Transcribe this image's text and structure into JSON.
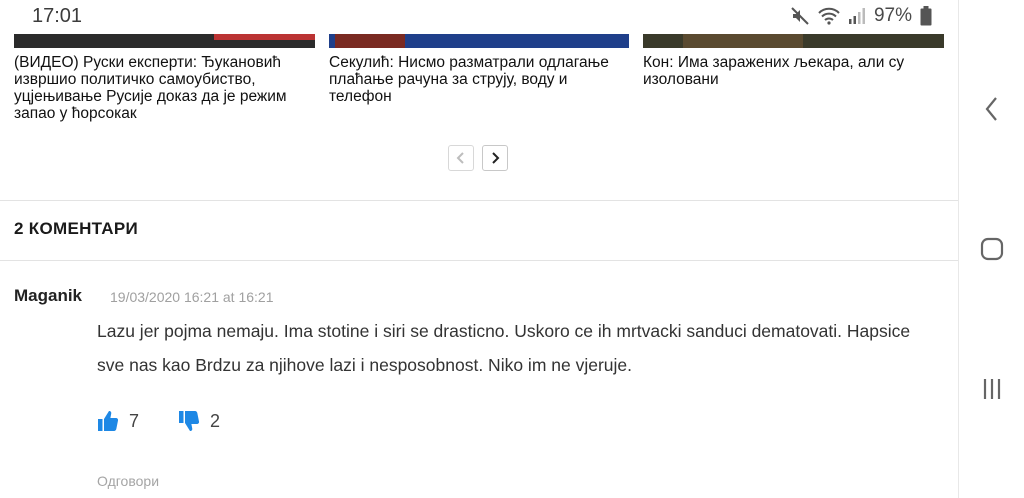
{
  "status_bar": {
    "time": "17:01",
    "battery": "97%",
    "icons": [
      "mute-icon",
      "wifi-icon",
      "signal-icon",
      "battery-icon"
    ]
  },
  "related_articles": [
    {
      "title": "(ВИДЕО) Руски експерти: Ђукановић извршио политичко самоубиство, уцјењивање Русије доказ да је режим запао у ћорсокак"
    },
    {
      "title": "Секулић: Нисмо разматрали одлагање плаћање рачуна за струју, воду и телефон"
    },
    {
      "title": "Кон: Има заражених љекара, али су изоловани"
    }
  ],
  "comments": {
    "header": "2 КОМЕНТАРИ",
    "items": [
      {
        "author": "Maganik",
        "date": "19/03/2020 16:21 at 16:21",
        "text": "Lazu jer pojma nemaju. Ima stotine i siri se drasticno. Uskoro ce ih mrtvacki sanduci dematovati. Hapsice sve nas kao Brdzu za njihove lazi i nesposobnost. Niko im ne vjeruje.",
        "likes": "7",
        "dislikes": "2",
        "reply_label": "Одговори"
      }
    ]
  },
  "colors": {
    "accent": "#1e88e5",
    "muted": "#a0a0a0"
  }
}
